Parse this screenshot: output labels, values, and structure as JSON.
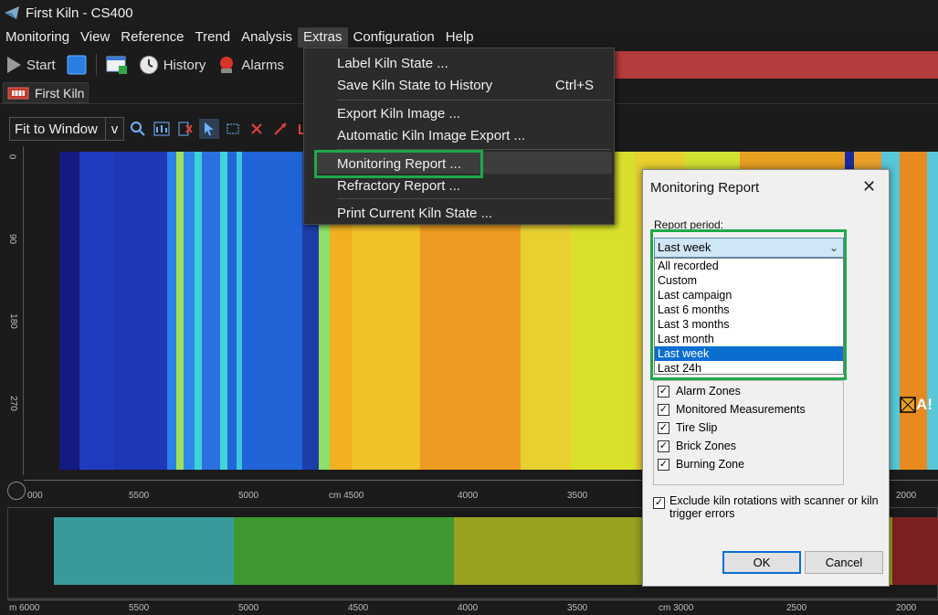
{
  "window": {
    "title": "First Kiln - CS400"
  },
  "menubar": [
    "Monitoring",
    "View",
    "Reference",
    "Trend",
    "Analysis",
    "Extras",
    "Configuration",
    "Help"
  ],
  "toolbar": {
    "start_label": "Start",
    "history_label": "History",
    "alarms_label": "Alarms"
  },
  "tab": {
    "label": "First Kiln"
  },
  "image_toolbar": {
    "zoom_value": "Fit to Window",
    "zoom_dropdown": "v"
  },
  "vruler": {
    "labels": [
      "0",
      "90",
      "180",
      "270"
    ]
  },
  "hruler": {
    "labels": [
      "000",
      "5500",
      "5000",
      "cm 4500",
      "4000",
      "3500",
      "2000"
    ]
  },
  "hruler2": {
    "labels": [
      "m 6000",
      "5500",
      "5000",
      "4500",
      "4000",
      "3500",
      "cm 3000",
      "2500",
      "2000"
    ]
  },
  "extras_menu": {
    "items": [
      {
        "label": "Label Kiln State ...",
        "shortcut": ""
      },
      {
        "label": "Save Kiln State to History",
        "shortcut": "Ctrl+S"
      },
      {
        "label": "Export Kiln Image ...",
        "shortcut": ""
      },
      {
        "label": "Automatic Kiln Image Export ...",
        "shortcut": ""
      },
      {
        "label": "Monitoring Report ...",
        "shortcut": ""
      },
      {
        "label": "Refractory Report ...",
        "shortcut": ""
      },
      {
        "label": "Print Current Kiln State ...",
        "shortcut": ""
      }
    ]
  },
  "dialog": {
    "title": "Monitoring Report",
    "close": "✕",
    "period_label": "Report period:",
    "period_value": "Last week",
    "period_options": [
      "All recorded",
      "Custom",
      "Last campaign",
      "Last 6 months",
      "Last 3 months",
      "Last month",
      "Last week",
      "Last 24h"
    ],
    "selected_option": "Last week",
    "checkboxes": [
      {
        "label": "Alarm Zones",
        "checked": true
      },
      {
        "label": "Monitored Measurements",
        "checked": true
      },
      {
        "label": "Tire Slip",
        "checked": true
      },
      {
        "label": "Brick Zones",
        "checked": true
      },
      {
        "label": "Burning Zone",
        "checked": true
      }
    ],
    "exclude_label": "Exclude kiln rotations with scanner or kiln trigger errors",
    "exclude_checked": true,
    "ok_label": "OK",
    "cancel_label": "Cancel"
  },
  "image_marker": {
    "label": "A!"
  },
  "colors": {
    "accent_green": "#1fa84a",
    "alarm_red": "#b43c3c",
    "selection_blue": "#0a6ed1",
    "zone_teal": "#3a9a9a",
    "zone_green": "#3e9a30",
    "zone_olive": "#9aa020",
    "zone_red": "#7a2222"
  }
}
